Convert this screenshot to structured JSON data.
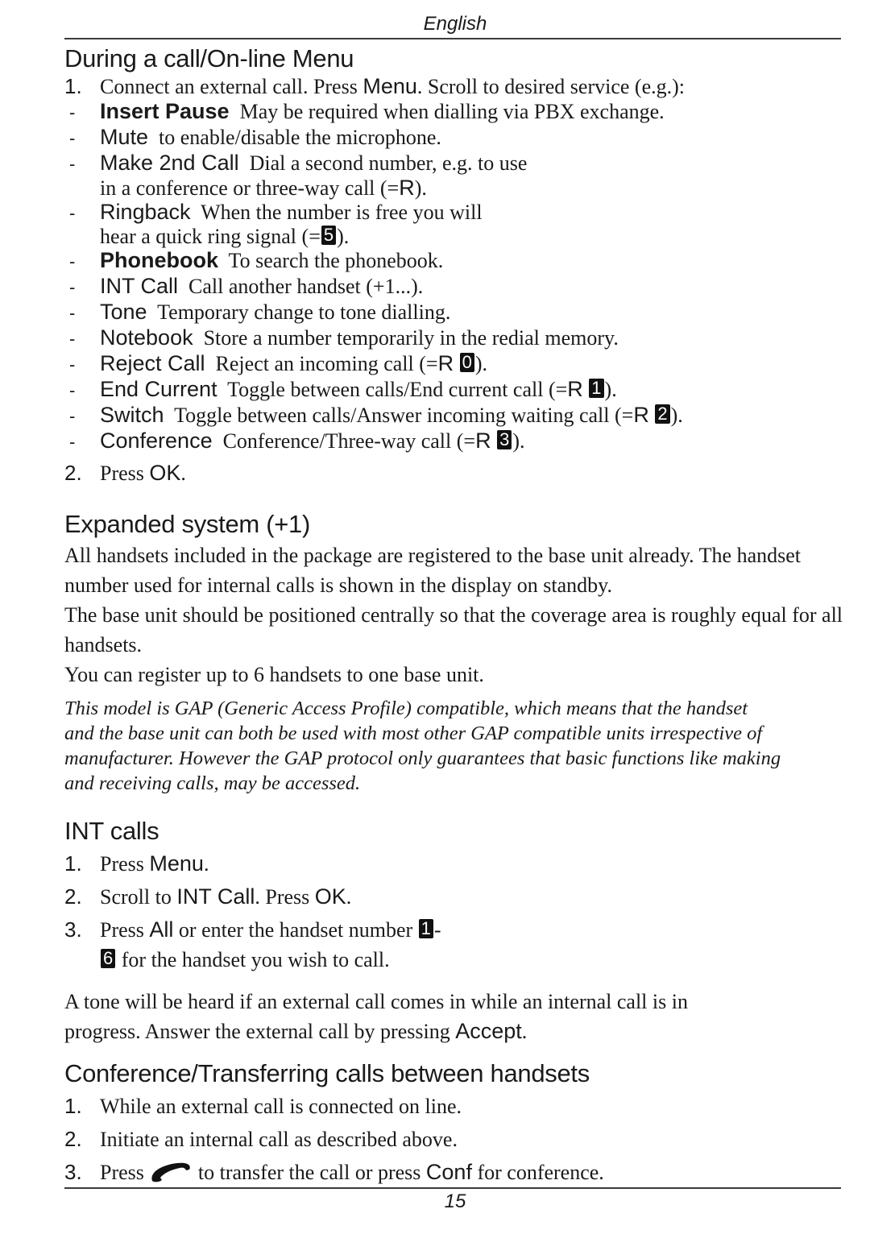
{
  "header": {
    "language": "English"
  },
  "footer": {
    "page_number": "15"
  },
  "section_online_menu": {
    "title": "During a call/On-line Menu",
    "step1": {
      "num": "1.",
      "text_a": "Connect an external call. Press ",
      "kw": "Menu",
      "text_b": ".  Scroll to desired service (e.g.):"
    },
    "items": [
      {
        "dash": "-",
        "kw": "Insert Pause",
        "bold": true,
        "desc": "May be required when dialling via PBX exchange."
      },
      {
        "dash": "-",
        "kw": "Mute",
        "desc": "to enable/disable the microphone."
      },
      {
        "dash": "-",
        "kw": "Make 2nd Call",
        "desc": "Dial a second number, e.g. to use",
        "cont_a": "in a conference or three-way call (=",
        "cont_kw": "R",
        "cont_b": ")."
      },
      {
        "dash": "-",
        "kw": "Ringback",
        "desc": "When the number is free you will",
        "cont_a": "hear a quick ring signal (=",
        "cont_key": "5",
        "cont_b": ")."
      },
      {
        "dash": "-",
        "kw": "Phonebook",
        "bold": true,
        "desc": "To search the phonebook."
      },
      {
        "dash": "-",
        "kw": "INT Call",
        "desc": "Call another handset (+1...)."
      },
      {
        "dash": "-",
        "kw": "Tone",
        "desc": "Temporary change to tone dialling."
      },
      {
        "dash": "-",
        "kw": "Notebook",
        "desc": "Store a number temporarily in the redial memory."
      },
      {
        "dash": "-",
        "kw": "Reject Call",
        "desc": "Reject an incoming call (=",
        "r": "R",
        "key": "0",
        "end": ")."
      },
      {
        "dash": "-",
        "kw": "End Current",
        "desc": "Toggle between calls/End current call (=",
        "r": "R",
        "key": "1",
        "end": ")."
      },
      {
        "dash": "-",
        "kw": "Switch",
        "desc": "Toggle between calls/Answer incoming waiting call (=",
        "r": "R",
        "key": "2",
        "end": ")."
      },
      {
        "dash": "-",
        "kw": "Conference",
        "desc": "Conference/Three-way call (=",
        "r": "R",
        "key": "3",
        "end": ")."
      }
    ],
    "step2": {
      "num": "2.",
      "text": "Press ",
      "kw": "OK",
      "end": "."
    }
  },
  "section_expanded": {
    "title": "Expanded system (+1)",
    "paragraphs": [
      "All handsets included in the package are registered to the base unit already. The handset number used for internal calls is shown in the display on standby.",
      "The base unit should be positioned centrally so that the coverage area is roughly equal for all handsets.",
      "You can register up to 6 handsets to one base unit."
    ],
    "note_lines": [
      "This model is GAP (Generic Access Profile) compatible, which means that the handset",
      "and the base unit can both be used with most other GAP compatible units irrespective of",
      "manufacturer. However the GAP protocol only guarantees that basic functions like making",
      "and receiving calls, may be accessed."
    ]
  },
  "section_int_calls": {
    "title": "INT calls",
    "steps": [
      {
        "num": "1.",
        "a": "Press ",
        "kw": "Menu",
        "b": "."
      },
      {
        "num": "2.",
        "a": "Scroll to ",
        "kw": "INT Call",
        "b": ". Press ",
        "kw2": "OK",
        "c": "."
      },
      {
        "num": "3.",
        "a": "Press ",
        "kw": "All",
        "b": " or enter the handset number ",
        "key1": "1",
        "sep": "-",
        "key2": "6",
        "c": " for the handset you wish to call."
      }
    ],
    "after_line1": "A tone will be heard if an external call comes in while an internal call is in",
    "after_line2_a": "progress. Answer the external call by pressing ",
    "after_kw": "Accept",
    "after_end": "."
  },
  "section_conference": {
    "title": "Conference/Transferring calls between handsets",
    "steps": [
      {
        "num": "1.",
        "text": "While an external call is connected on line."
      },
      {
        "num": "2.",
        "text": "Initiate an internal call as described above."
      },
      {
        "num": "3.",
        "a": "Press ",
        "icon": "handset-icon",
        "b": " to transfer the call or press ",
        "kw": "Conf",
        "c": " for conference."
      }
    ]
  }
}
